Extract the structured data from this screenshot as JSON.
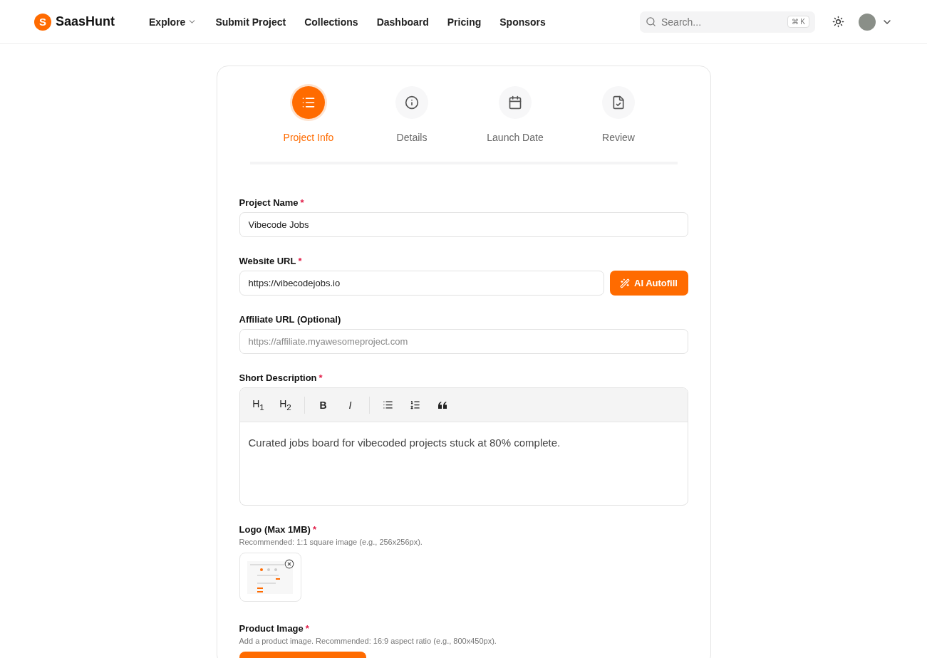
{
  "header": {
    "logo": {
      "mark": "S",
      "name": "SaasHunt"
    },
    "nav": [
      {
        "label": "Explore",
        "has_menu": true
      },
      {
        "label": "Submit Project",
        "has_menu": false
      },
      {
        "label": "Collections",
        "has_menu": false
      },
      {
        "label": "Dashboard",
        "has_menu": false
      },
      {
        "label": "Pricing",
        "has_menu": false
      },
      {
        "label": "Sponsors",
        "has_menu": false
      }
    ],
    "search": {
      "placeholder": "Search...",
      "shortcut": "⌘ K"
    }
  },
  "steps": [
    {
      "label": "Project Info",
      "selected": true
    },
    {
      "label": "Details",
      "selected": false
    },
    {
      "label": "Launch Date",
      "selected": false
    },
    {
      "label": "Review",
      "selected": false
    }
  ],
  "project_name": {
    "label": "Project Name",
    "marker": "*",
    "value": "Vibecode Jobs"
  },
  "website_url": {
    "label": "Website URL",
    "marker": "*",
    "value": "https://vibecodejobs.io",
    "button": "AI Autofill"
  },
  "affiliate_url": {
    "label": "Affiliate URL (Optional)",
    "placeholder": "https://affiliate.myawesomeproject.com"
  },
  "short_description": {
    "label": "Short Description",
    "marker": "*",
    "toolbar": [
      {
        "kind": "text",
        "text": "H$_{1}$"
      },
      {
        "kind": "text",
        "text": "H$_{2}$"
      },
      {
        "kind": "separator"
      },
      {
        "kind": "bold",
        "text": "B"
      },
      {
        "kind": "italic",
        "text": "I"
      },
      {
        "kind": "separator"
      },
      {
        "kind": "bullets"
      },
      {
        "kind": "numbers"
      },
      {
        "kind": "quote"
      }
    ],
    "value": "Curated jobs board for vibecoded projects stuck at 80% complete."
  },
  "logo_upload": {
    "label": "Logo (Max 1MB)",
    "marker": "*",
    "hint": "Recommended: 1:1 square image (e.g., 256x256px)."
  },
  "product_image": {
    "label": "Product Image",
    "marker": "*",
    "hint": "Add a product image. Recommended: 16:9 aspect ratio (e.g., 800x450px)."
  }
}
